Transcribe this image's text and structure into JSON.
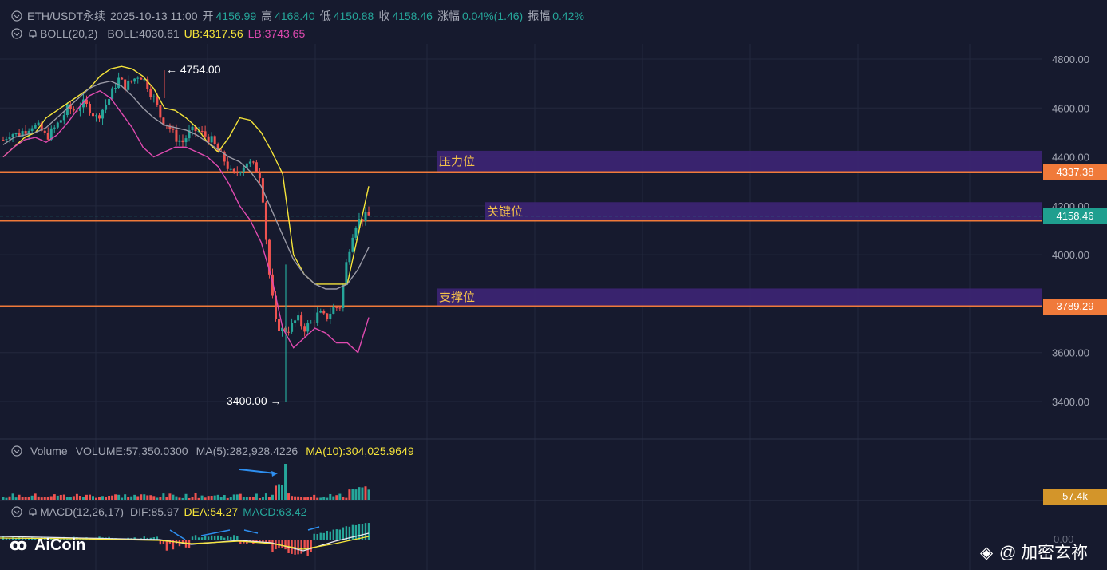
{
  "header": {
    "symbol": "ETH/USDT永续",
    "datetime": "2025-10-13 11:00",
    "open_label": "开",
    "open": "4156.99",
    "high_label": "高",
    "high": "4168.40",
    "low_label": "低",
    "low": "4150.88",
    "close_label": "收",
    "close": "4158.46",
    "change_label": "涨幅",
    "change": "0.04%(1.46)",
    "amp_label": "振幅",
    "amp": "0.42%"
  },
  "boll_header": {
    "name": "BOLL(20,2)",
    "boll": "BOLL:4030.61",
    "ub": "UB:4317.56",
    "lb": "LB:3743.65"
  },
  "volume_header": {
    "name": "Volume",
    "volume": "VOLUME:57,350.0300",
    "ma5": "MA(5):282,928.4226",
    "ma10": "MA(10):304,025.9649"
  },
  "macd_header": {
    "name": "MACD(12,26,17)",
    "dif": "DIF:85.97",
    "dea": "DEA:54.27",
    "macd": "MACD:63.42"
  },
  "tags": {
    "resistance": "4337.38",
    "current": "4158.46",
    "support": "3789.29",
    "volume": "57.4k",
    "macd_zero": "0.00"
  },
  "zones": {
    "resistance_label": "压力位",
    "key_label": "关键位",
    "support_label": "支撑位"
  },
  "annotations": {
    "high": "4754.00",
    "low": "3400.00"
  },
  "watermarks": {
    "left": "AiCoin",
    "right": "@ 加密玄祢"
  },
  "colors": {
    "up": "#26a69a",
    "down": "#ef5350",
    "ub": "#f5e43a",
    "lb": "#e04ab0",
    "mid": "#9a9aa6",
    "level_line": "#f07a3a",
    "zone": "#3b2472"
  },
  "chart_data": {
    "type": "candlestick",
    "yticks": [
      4800,
      4600,
      4400,
      4200,
      4000,
      3600,
      3400
    ],
    "ylim": [
      3260,
      4880
    ],
    "levels": {
      "resistance": 4337.38,
      "key": 4140,
      "support": 3789.29,
      "current": 4158.46
    },
    "zones": [
      {
        "name": "压力位",
        "low": 4337.38,
        "high": 4425
      },
      {
        "name": "关键位",
        "low": 4140,
        "high": 4215
      },
      {
        "name": "支撑位",
        "low": 3789.29,
        "high": 3862
      }
    ],
    "price_path": [
      4470,
      4500,
      4490,
      4510,
      4530,
      4520,
      4480,
      4510,
      4550,
      4600,
      4590,
      4620,
      4600,
      4560,
      4600,
      4650,
      4720,
      4690,
      4710,
      4740,
      4700,
      4640,
      4560,
      4530,
      4480,
      4460,
      4500,
      4510,
      4490,
      4470,
      4420,
      4380,
      4320,
      4350,
      4380,
      4360,
      4320,
      3950,
      3720,
      3690,
      3700,
      3740,
      3700,
      3720,
      3760,
      3740,
      3780,
      3790,
      3990,
      4120,
      4150,
      4158.46
    ],
    "boll_ub": [
      4400,
      4440,
      4480,
      4500,
      4560,
      4590,
      4620,
      4650,
      4680,
      4730,
      4760,
      4770,
      4760,
      4730,
      4680,
      4600,
      4590,
      4560,
      4520,
      4460,
      4420,
      4480,
      4560,
      4550,
      4500,
      4420,
      4330,
      4000,
      3920,
      3880,
      3880,
      3880,
      3880,
      4080,
      4280
    ],
    "boll_mid": [
      4450,
      4480,
      4490,
      4500,
      4520,
      4560,
      4600,
      4640,
      4680,
      4700,
      4710,
      4690,
      4650,
      4600,
      4560,
      4530,
      4520,
      4510,
      4490,
      4460,
      4430,
      4400,
      4380,
      4340,
      4280,
      4180,
      4080,
      3980,
      3920,
      3880,
      3860,
      3860,
      3880,
      3940,
      4030
    ],
    "boll_lb": [
      4400,
      4440,
      4470,
      4480,
      4460,
      4490,
      4540,
      4600,
      4650,
      4670,
      4640,
      4580,
      4520,
      4440,
      4400,
      4420,
      4440,
      4440,
      4420,
      4400,
      4360,
      4290,
      4200,
      4140,
      4050,
      3900,
      3700,
      3620,
      3660,
      3700,
      3680,
      3640,
      3640,
      3600,
      3744
    ]
  }
}
